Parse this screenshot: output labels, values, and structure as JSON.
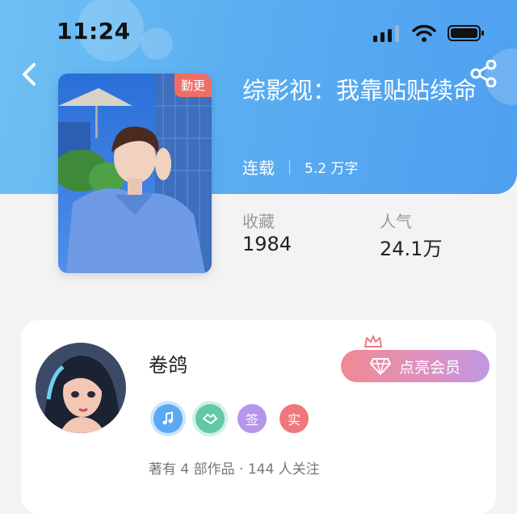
{
  "status": {
    "time": "11:24"
  },
  "book": {
    "badge": "勤更",
    "title": "综影视：我靠贴贴续命",
    "status": "连载",
    "words": "5.2 万字",
    "stats": [
      {
        "label": "收藏",
        "value": "1984"
      },
      {
        "label": "人气",
        "value": "24.1万"
      }
    ]
  },
  "author": {
    "name": "卷鸽",
    "badges": [
      {
        "icon": "music-note-icon",
        "color": "#5aa9f2"
      },
      {
        "icon": "handshake-icon",
        "color": "#62c8a6"
      },
      {
        "text": "签",
        "color": "#b795ea"
      },
      {
        "text": "实",
        "color": "#f0777b"
      }
    ],
    "stats_text": "著有 4 部作品 · 144 人关注",
    "vip_label": "点亮会员"
  },
  "colors": {
    "header": "#5aaef0",
    "badge": "#ee6e66"
  }
}
